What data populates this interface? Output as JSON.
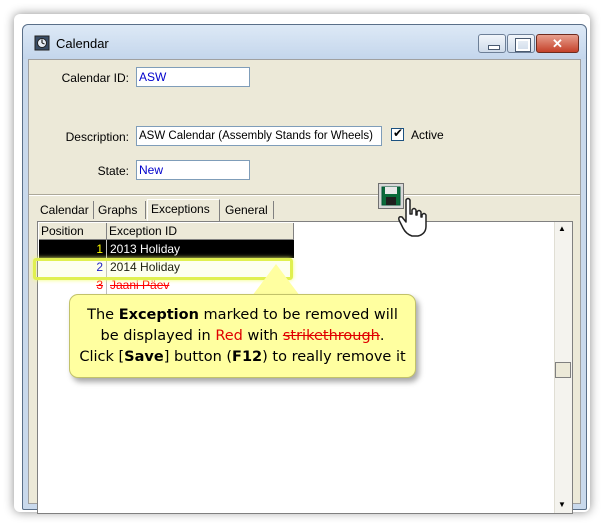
{
  "window": {
    "title": "Calendar"
  },
  "form": {
    "calendar_id_label": "Calendar ID:",
    "calendar_id_value": "ASW",
    "description_label": "Description:",
    "description_value": "ASW Calendar (Assembly Stands for Wheels)",
    "active_label": "Active",
    "active_checked": true,
    "state_label": "State:",
    "state_value": "New"
  },
  "tabs": [
    "Calendar",
    "Graphs",
    "Exceptions",
    "General"
  ],
  "selected_tab": "Exceptions",
  "grid": {
    "headers": [
      "Position",
      "Exception ID"
    ],
    "rows": [
      {
        "position": "1",
        "exception_id": "2013 Holiday",
        "state": "selected"
      },
      {
        "position": "2",
        "exception_id": "2014 Holiday",
        "state": "normal"
      },
      {
        "position": "3",
        "exception_id": "Jaani Päev",
        "state": "removed"
      }
    ]
  },
  "callout": {
    "t1": "The ",
    "b1": "Exception",
    "t2": " marked to be removed will",
    "t3": "be displayed in ",
    "red": "Red",
    "t4": " with ",
    "strike": "strikethrough",
    "t5": ".",
    "t6": "Click [",
    "b2": "Save",
    "t7": "] button (",
    "b3": "F12",
    "t8": ") to really remove it"
  },
  "colors": {
    "removed_row": "#ff0000",
    "callout_bg": "#ffffa0",
    "highlight": "#e0f050"
  },
  "icons": [
    "calendar-app-icon",
    "save-icon",
    "hand-pointer-icon",
    "minimize-icon",
    "maximize-icon",
    "close-icon",
    "checkmark-icon",
    "scroll-up-arrow-icon",
    "scroll-down-arrow-icon"
  ]
}
